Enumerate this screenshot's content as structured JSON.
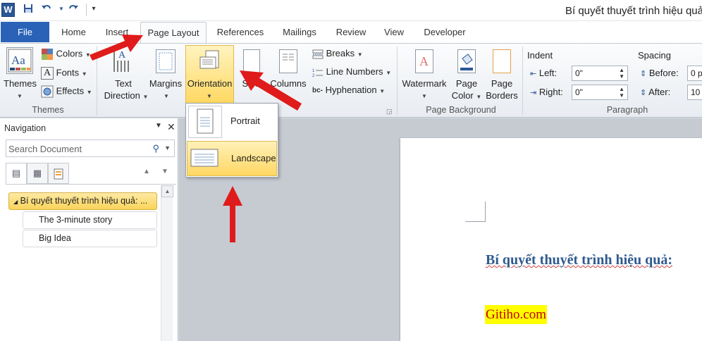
{
  "window": {
    "title": "Bí quyết thuyết trình hiệu quả"
  },
  "quick_access": {
    "app_icon": "word-icon",
    "save": "save-icon",
    "undo": "undo-icon",
    "redo": "redo-icon",
    "customize": "customize-icon"
  },
  "tabs": [
    {
      "label": "File"
    },
    {
      "label": "Home"
    },
    {
      "label": "Insert"
    },
    {
      "label": "Page Layout"
    },
    {
      "label": "References"
    },
    {
      "label": "Mailings"
    },
    {
      "label": "Review"
    },
    {
      "label": "View"
    },
    {
      "label": "Developer"
    }
  ],
  "ribbon": {
    "themes_group": {
      "themes_label": "Themes",
      "colors_label": "Colors",
      "fonts_label": "Fonts",
      "effects_label": "Effects",
      "group_label": "Themes"
    },
    "page_setup": {
      "text_direction_line1": "Text",
      "text_direction_line2": "Direction",
      "margins_label": "Margins",
      "orientation_label": "Orientation",
      "size_label": "Size",
      "columns_label": "Columns",
      "breaks_label": "Breaks",
      "line_numbers_label": "Line Numbers",
      "hyphenation_label": "Hyphenation"
    },
    "page_background": {
      "watermark_label": "Watermark",
      "page_color_line1": "Page",
      "page_color_line2": "Color",
      "page_borders_line1": "Page",
      "page_borders_line2": "Borders",
      "group_label": "Page Background"
    },
    "paragraph": {
      "indent_label": "Indent",
      "left_label": "Left:",
      "left_value": "0\"",
      "right_label": "Right:",
      "right_value": "0\"",
      "spacing_label": "Spacing",
      "before_label": "Before:",
      "before_value": "0 p",
      "after_label": "After:",
      "after_value": "10",
      "group_label": "Paragraph"
    }
  },
  "orientation_menu": {
    "items": [
      {
        "label": "Portrait"
      },
      {
        "label": "Landscape"
      }
    ],
    "highlighted": "Landscape"
  },
  "navigation": {
    "title": "Navigation",
    "search_placeholder": "Search Document",
    "items": [
      {
        "label": "Bí quyết thuyết trình hiệu quả: ..."
      },
      {
        "label": "The 3-minute story"
      },
      {
        "label": "Big Idea"
      }
    ]
  },
  "document": {
    "heading": "Bí quyết thuyết trình hiệu quả:",
    "highlighted_text": "Gitiho.com"
  },
  "colors": {
    "accent_red": "#e01b1b",
    "file_tab": "#2a62b8",
    "highlight_yellow": "#ffff00"
  }
}
